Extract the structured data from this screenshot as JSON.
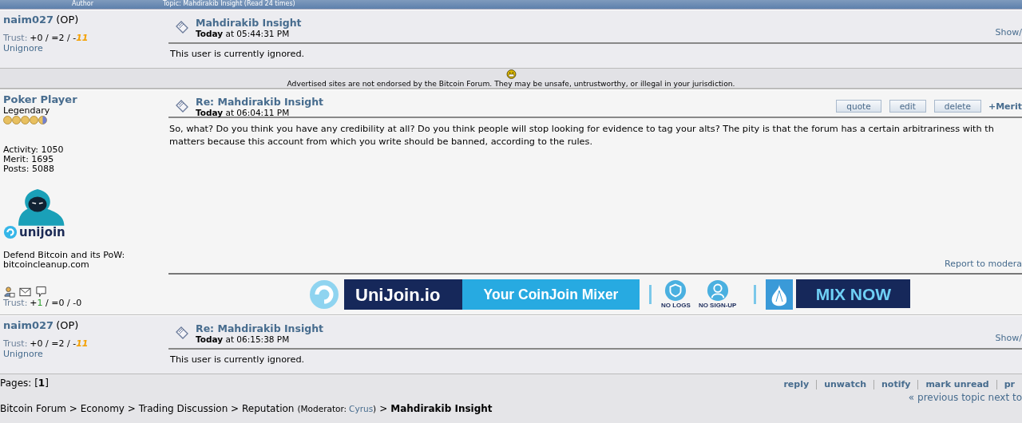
{
  "header": {
    "author_label": "Author",
    "topic_label": "Topic: Mahdirakib Insight  (Read 24 times)"
  },
  "posts": [
    {
      "kind": "ignored",
      "author": "naim027",
      "tag": "(OP)",
      "trust_label": "Trust:",
      "trust": [
        {
          "text": "+0 / =2 / -",
          "kind": "plain"
        },
        {
          "text": "11",
          "kind": "negative"
        }
      ],
      "unignore": "Unignore",
      "subject": "Mahdirakib Insight",
      "date_day": "Today",
      "date_rest": "at 05:44:31 PM",
      "toggle": "Show/",
      "body": [
        "This user is currently ignored."
      ]
    },
    {
      "kind": "notice",
      "text": "Advertised sites are not endorsed by the Bitcoin Forum. They may be unsafe, untrustworthy, or illegal in your jurisdiction."
    },
    {
      "kind": "full",
      "author": "Poker Player",
      "rank": "Legendary",
      "stars": 4.5,
      "stats": [
        "Activity: 1050",
        "Merit: 1695",
        "Posts: 5088"
      ],
      "avatar_logo": "unijoin",
      "personal": [
        "Defend Bitcoin and its PoW:",
        "bitcoincleanup.com"
      ],
      "trust_label": "Trust:",
      "trust": [
        {
          "text": "+",
          "kind": "plain"
        },
        {
          "text": "1",
          "kind": "positive"
        },
        {
          "text": " / =0 / -0",
          "kind": "plain"
        }
      ],
      "subject": "Re: Mahdirakib Insight",
      "date_day": "Today",
      "date_rest": "at 06:04:11 PM",
      "buttons": [
        "quote",
        "edit",
        "delete"
      ],
      "merit": "+Merit",
      "body": [
        "So, what? Do you think you have any credibility at all? Do you think people will stop looking for evidence to tag your alts? The pity is that the forum has a certain arbitrariness with th",
        "matters because this account from which you write should be banned, according to the rules."
      ],
      "report": "Report to modera",
      "banner": {
        "brand": "UniJoin.io",
        "slogan": "Your CoinJoin Mixer",
        "feature_1": "NO LOGS",
        "feature_2": "NO SIGN-UP",
        "cta": "MIX NOW"
      }
    },
    {
      "kind": "ignored",
      "author": "naim027",
      "tag": "(OP)",
      "trust_label": "Trust:",
      "trust": [
        {
          "text": "+0 / =2 / -",
          "kind": "plain"
        },
        {
          "text": "11",
          "kind": "negative"
        }
      ],
      "unignore": "Unignore",
      "subject": "Re: Mahdirakib Insight",
      "date_day": "Today",
      "date_rest": "at 06:15:38 PM",
      "toggle": "Show/",
      "body": [
        "This user is currently ignored."
      ]
    }
  ],
  "footer": {
    "pages_label": "Pages:",
    "pages_current": "[**1**]",
    "actions": [
      "reply",
      "unwatch",
      "notify",
      "mark unread",
      "pr"
    ],
    "topic_nav": "« previous topic next to",
    "breadcrumb": {
      "path": "Bitcoin Forum > Economy > Trading Discussion > Reputation",
      "moderator_open": "(Moderator:",
      "moderator": "Cyrus",
      "moderator_close": ")",
      "separator": ">",
      "current": "Mahdirakib Insight"
    }
  }
}
